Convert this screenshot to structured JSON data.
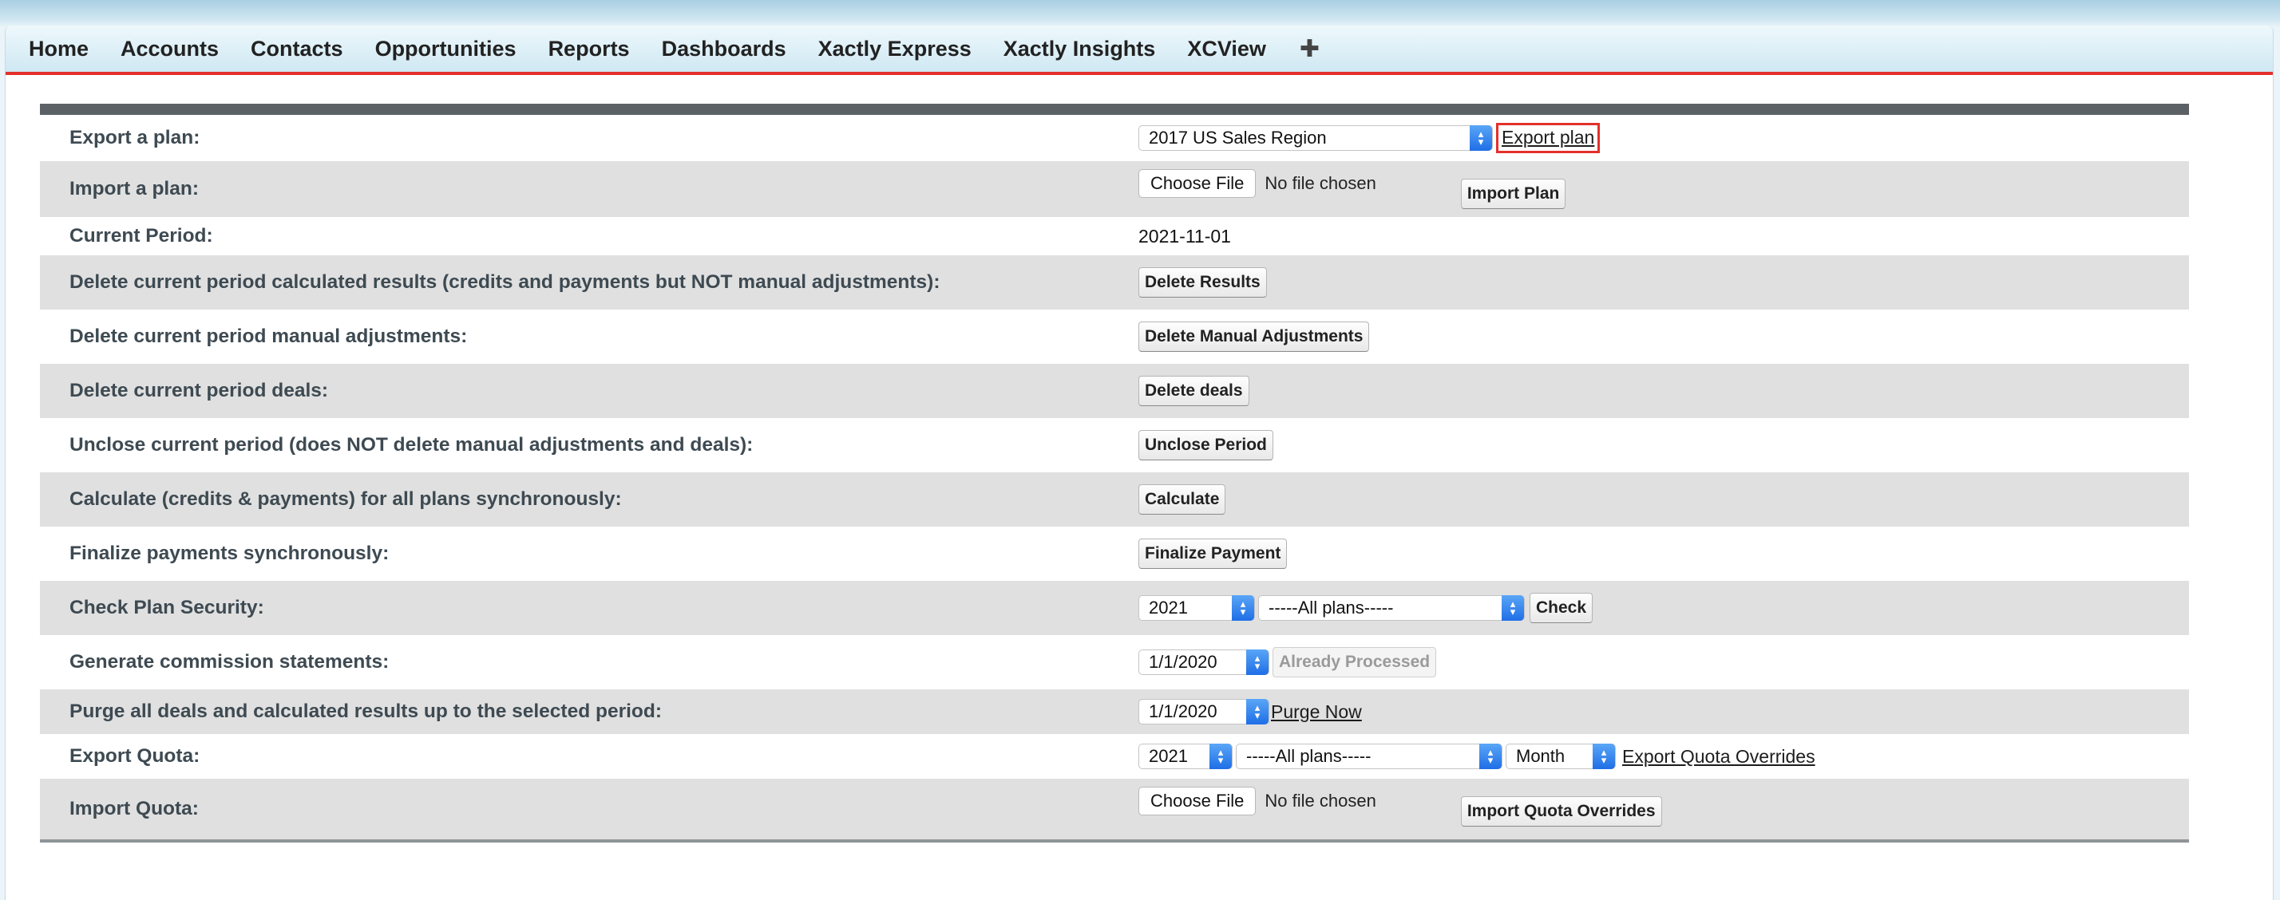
{
  "nav": {
    "tabs": [
      "Home",
      "Accounts",
      "Contacts",
      "Opportunities",
      "Reports",
      "Dashboards",
      "Xactly Express",
      "Xactly Insights",
      "XCView"
    ],
    "plus": "✚"
  },
  "rows": {
    "export_plan": {
      "label": "Export a plan:",
      "plan_select": "2017 US Sales Region",
      "link": "Export plan"
    },
    "import_plan": {
      "label": "Import a plan:",
      "file_button": "Choose File",
      "file_status": "No file chosen",
      "button": "Import Plan"
    },
    "current_period": {
      "label": "Current Period:",
      "value": "2021-11-01"
    },
    "delete_results": {
      "label": "Delete current period calculated results (credits and payments but NOT manual adjustments):",
      "button": "Delete Results"
    },
    "delete_adjustments": {
      "label": "Delete current period manual adjustments:",
      "button": "Delete Manual Adjustments"
    },
    "delete_deals": {
      "label": "Delete current period deals:",
      "button": "Delete deals"
    },
    "unclose": {
      "label": "Unclose current period (does NOT delete manual adjustments and deals):",
      "button": "Unclose Period"
    },
    "calculate": {
      "label": "Calculate (credits & payments) for all plans synchronously:",
      "button": "Calculate"
    },
    "finalize": {
      "label": "Finalize payments synchronously:",
      "button": "Finalize Payment"
    },
    "plan_security": {
      "label": "Check Plan Security:",
      "year_select": "2021",
      "plans_select": "-----All plans-----",
      "button": "Check"
    },
    "statements": {
      "label": "Generate commission statements:",
      "date_select": "1/1/2020",
      "button": "Already Processed"
    },
    "purge": {
      "label": "Purge all deals and calculated results up to the selected period:",
      "date_select": "1/1/2020",
      "link": "Purge Now"
    },
    "export_quota": {
      "label": "Export Quota:",
      "year_select": "2021",
      "plans_select": "-----All plans-----",
      "period_select": "Month",
      "link": "Export Quota Overrides"
    },
    "import_quota": {
      "label": "Import Quota:",
      "file_button": "Choose File",
      "file_status": "No file chosen",
      "button": "Import Quota Overrides"
    }
  },
  "colors": {
    "accent_red": "#e3302c",
    "select_blue": "#1f6ee6",
    "row_gray": "#e0e0e0"
  }
}
